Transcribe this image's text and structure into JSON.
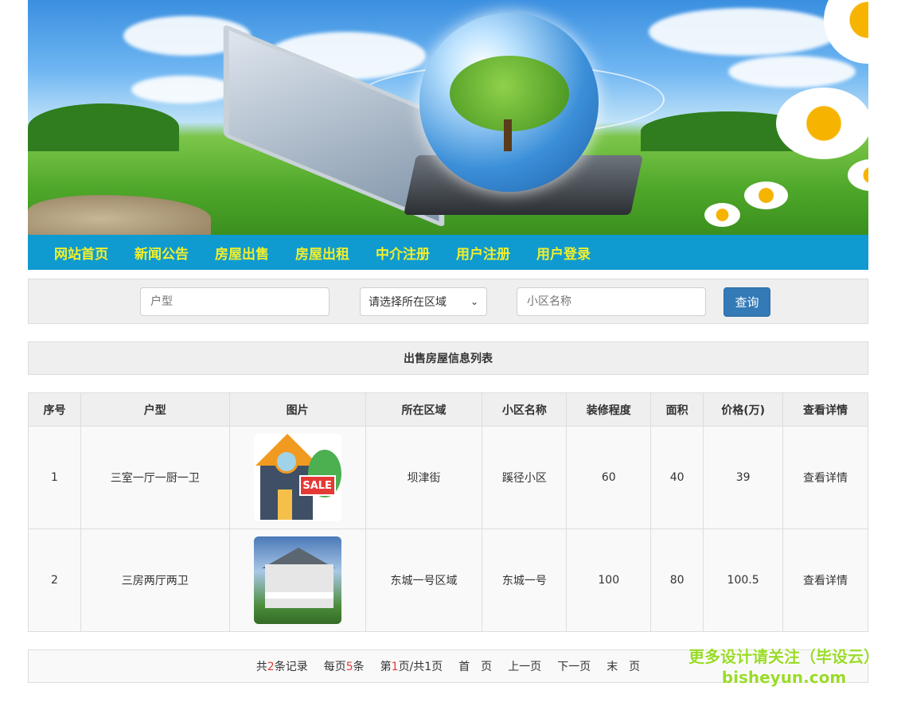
{
  "nav": {
    "items": [
      "网站首页",
      "新闻公告",
      "房屋出售",
      "房屋出租",
      "中介注册",
      "用户注册",
      "用户登录"
    ]
  },
  "search": {
    "house_type_placeholder": "户型",
    "area_select_value": "请选择所在区域",
    "community_placeholder": "小区名称",
    "query_button": "查询"
  },
  "list": {
    "title": "出售房屋信息列表",
    "headers": [
      "序号",
      "户型",
      "图片",
      "所在区域",
      "小区名称",
      "装修程度",
      "面积",
      "价格(万)",
      "查看详情"
    ],
    "rows": [
      {
        "no": "1",
        "type": "三室一厅一厨一卫",
        "image": "house-sale-icon",
        "region": "坝津街",
        "community": "蹊径小区",
        "decoration": "60",
        "area": "40",
        "price": "39",
        "detail": "查看详情"
      },
      {
        "no": "2",
        "type": "三房两厅两卫",
        "image": "house-photo",
        "region": "东城一号区域",
        "community": "东城一号",
        "decoration": "100",
        "area": "80",
        "price": "100.5",
        "detail": "查看详情"
      }
    ]
  },
  "pager": {
    "total_pre": "共",
    "total_count": "2",
    "total_post": "条记录",
    "per_pre": "每页",
    "per_count": "5",
    "per_post": "条",
    "page_pre": "第",
    "page_current": "1",
    "page_post": "页/共1页",
    "first": "首　页",
    "prev": "上一页",
    "next": "下一页",
    "last": "末　页"
  },
  "watermark": {
    "line1": "更多设计请关注（毕设云）",
    "line2": "bisheyun.com"
  },
  "colors": {
    "nav_bg": "#0f9bd0",
    "nav_text": "#f2ef2a",
    "button_bg": "#337ab7",
    "highlight": "#e53935"
  }
}
